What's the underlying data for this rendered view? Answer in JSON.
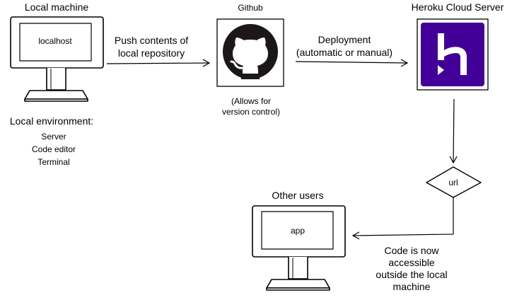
{
  "nodes": {
    "local_machine": {
      "title": "Local machine",
      "screen_text": "localhost",
      "env_title": "Local environment:",
      "env_items": [
        "Server",
        "Code editor",
        "Terminal"
      ]
    },
    "github": {
      "title": "Github",
      "caption": "(Allows for\nversion control)",
      "logo": "github-logo-icon"
    },
    "heroku": {
      "title": "Heroku Cloud Server",
      "logo": "heroku-logo-icon",
      "brand_color": "#430098"
    },
    "url": {
      "label": "url"
    },
    "other_users": {
      "title": "Other users",
      "screen_text": "app"
    }
  },
  "edges": {
    "push": "Push contents of\nlocal repository",
    "deploy": "Deployment\n(automatic or manual)",
    "accessible": "Code is now\naccessible\noutside the local\nmachine"
  }
}
